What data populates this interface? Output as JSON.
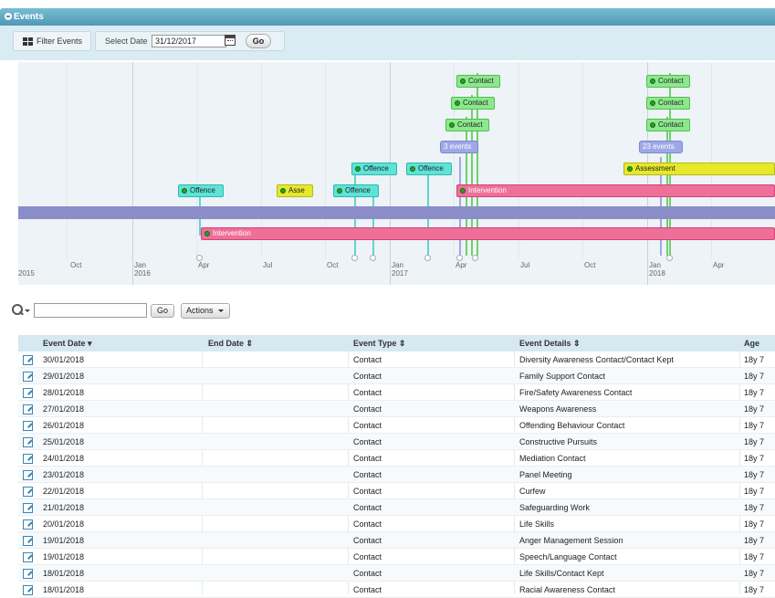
{
  "window": {
    "title": "Events"
  },
  "toolbar": {
    "filter_label": "Filter Events",
    "select_date_label": "Select Date",
    "date_value": "31/12/2017",
    "go_label": "Go"
  },
  "timeline": {
    "ticks": {
      "oct15": "Oct",
      "jan16": "Jan",
      "y2015": "2015",
      "y2016": "2016",
      "apr16": "Apr",
      "jul16": "Jul",
      "oct16": "Oct",
      "jan17": "Jan",
      "y2017": "2017",
      "apr17": "Apr",
      "jul17": "Jul",
      "oct17": "Oct",
      "jan18": "Jan",
      "y2018": "2018",
      "apr18": "Apr"
    },
    "events": {
      "contact": "Contact",
      "offence": "Offence",
      "asse": "Asse",
      "intervention": "Intervention",
      "assessment": "Assessment",
      "count_3": "3 events",
      "count_23": "23 events"
    }
  },
  "search": {
    "go_label": "Go",
    "actions_label": "Actions"
  },
  "table": {
    "headers": {
      "event_date": "Event Date",
      "end_date": "End Date",
      "event_type": "Event Type",
      "event_details": "Event Details",
      "age": "Age"
    },
    "rows": [
      {
        "date": "30/01/2018",
        "type": "Contact",
        "details": "Diversity Awareness Contact/Contact Kept",
        "age": "18y 7"
      },
      {
        "date": "29/01/2018",
        "type": "Contact",
        "details": "Family Support Contact",
        "age": "18y 7"
      },
      {
        "date": "28/01/2018",
        "type": "Contact",
        "details": "Fire/Safety Awareness Contact",
        "age": "18y 7"
      },
      {
        "date": "27/01/2018",
        "type": "Contact",
        "details": "Weapons Awareness",
        "age": "18y 7"
      },
      {
        "date": "26/01/2018",
        "type": "Contact",
        "details": "Offending Behaviour Contact",
        "age": "18y 7"
      },
      {
        "date": "25/01/2018",
        "type": "Contact",
        "details": "Constructive Pursuits",
        "age": "18y 7"
      },
      {
        "date": "24/01/2018",
        "type": "Contact",
        "details": "Mediation Contact",
        "age": "18y 7"
      },
      {
        "date": "23/01/2018",
        "type": "Contact",
        "details": "Panel Meeting",
        "age": "18y 7"
      },
      {
        "date": "22/01/2018",
        "type": "Contact",
        "details": "Curfew",
        "age": "18y 7"
      },
      {
        "date": "21/01/2018",
        "type": "Contact",
        "details": "Safeguarding Work",
        "age": "18y 7"
      },
      {
        "date": "20/01/2018",
        "type": "Contact",
        "details": "Life Skills",
        "age": "18y 7"
      },
      {
        "date": "19/01/2018",
        "type": "Contact",
        "details": "Anger Management Session",
        "age": "18y 7"
      },
      {
        "date": "19/01/2018",
        "type": "Contact",
        "details": "Speech/Language Contact",
        "age": "18y 7"
      },
      {
        "date": "18/01/2018",
        "type": "Contact",
        "details": "Life Skills/Contact Kept",
        "age": "18y 7"
      },
      {
        "date": "18/01/2018",
        "type": "Contact",
        "details": "Racial Awareness Contact",
        "age": "18y 7"
      }
    ]
  },
  "colors": {
    "contact": "#8de88d",
    "offence": "#5ee3d8",
    "assessment": "#e6e82a",
    "intervention": "#ee6f98",
    "band": "#8a8dc7",
    "header": "#4f98b4"
  }
}
